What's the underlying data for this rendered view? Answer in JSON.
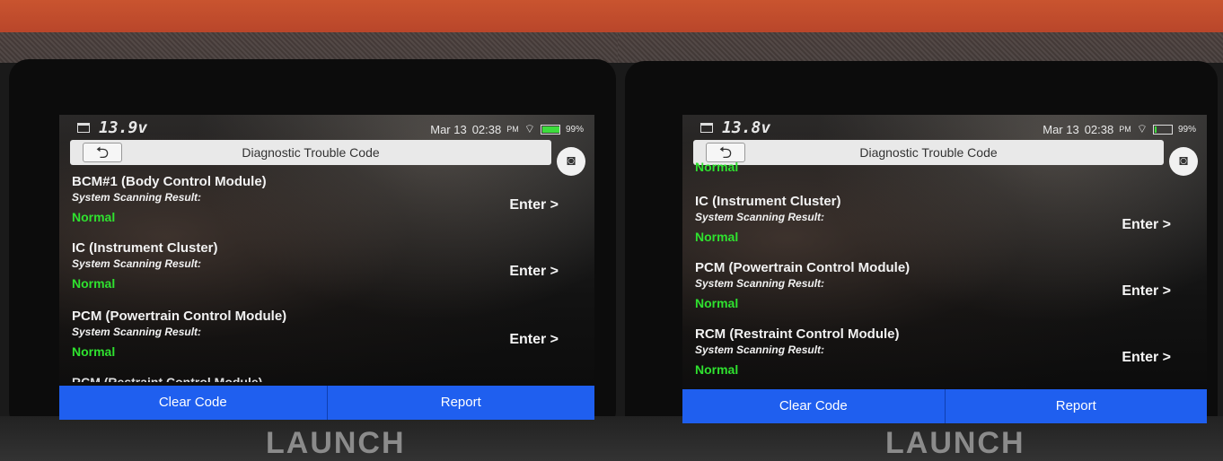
{
  "brand": "LAUNCH",
  "colors": {
    "status_normal": "#2fe12f",
    "action_bar": "#1f5fef"
  },
  "panels": [
    {
      "status": {
        "voltage": "13.9v",
        "date": "Mar 13",
        "time": "02:38",
        "ampm": "PM",
        "battery": "99%"
      },
      "title": "Diagnostic Trouble Code",
      "back_icon": "back-arrow-icon",
      "camera_icon": "camera-icon",
      "top_status": "",
      "modules": [
        {
          "name": "BCM#1 (Body Control Module)",
          "scan_label": "System Scanning Result:",
          "status": "Normal",
          "enter": "Enter >"
        },
        {
          "name": "IC (Instrument Cluster)",
          "scan_label": "System Scanning Result:",
          "status": "Normal",
          "enter": "Enter >"
        },
        {
          "name": "PCM (Powertrain Control Module)",
          "scan_label": "System Scanning Result:",
          "status": "Normal",
          "enter": "Enter >"
        }
      ],
      "partial_module": "RCM (Restraint Control Module)",
      "actions": {
        "clear": "Clear Code",
        "report": "Report"
      }
    },
    {
      "status": {
        "voltage": "13.8v",
        "date": "Mar 13",
        "time": "02:38",
        "ampm": "PM",
        "battery": "99%"
      },
      "title": "Diagnostic Trouble Code",
      "back_icon": "back-arrow-icon",
      "camera_icon": "camera-icon",
      "top_status": "Normal",
      "modules": [
        {
          "name": "IC (Instrument Cluster)",
          "scan_label": "System Scanning Result:",
          "status": "Normal",
          "enter": "Enter >"
        },
        {
          "name": "PCM (Powertrain Control Module)",
          "scan_label": "System Scanning Result:",
          "status": "Normal",
          "enter": "Enter >"
        },
        {
          "name": "RCM (Restraint Control Module)",
          "scan_label": "System Scanning Result:",
          "status": "Normal",
          "enter": "Enter >"
        }
      ],
      "partial_module": "",
      "actions": {
        "clear": "Clear Code",
        "report": "Report"
      }
    }
  ]
}
